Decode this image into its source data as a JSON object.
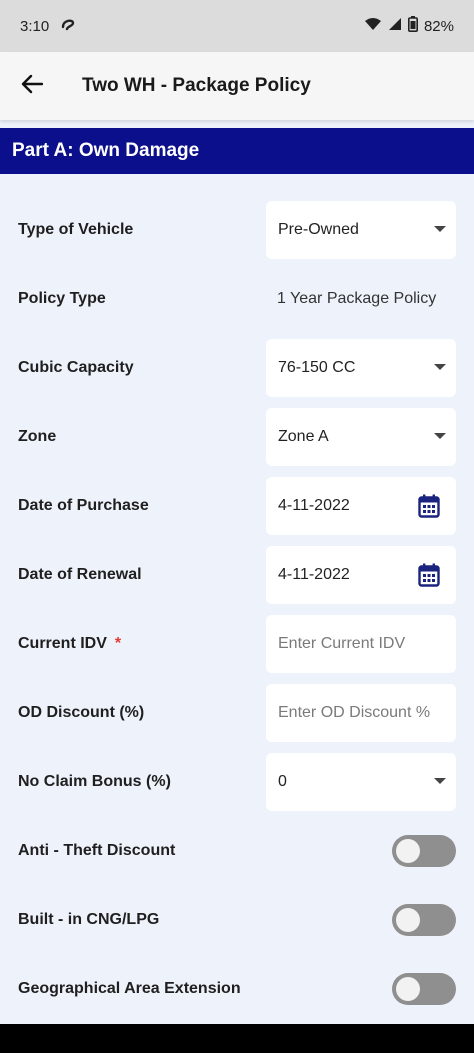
{
  "status": {
    "time": "3:10",
    "battery": "82%"
  },
  "header": {
    "title": "Two WH - Package Policy"
  },
  "section": {
    "title": "Part A: Own Damage"
  },
  "form": {
    "vehicle_type": {
      "label": "Type of Vehicle",
      "value": "Pre-Owned"
    },
    "policy_type": {
      "label": "Policy Type",
      "value": "1 Year Package Policy"
    },
    "cubic_capacity": {
      "label": "Cubic Capacity",
      "value": "76-150 CC"
    },
    "zone": {
      "label": "Zone",
      "value": "Zone A"
    },
    "date_purchase": {
      "label": "Date of Purchase",
      "value": "4-11-2022"
    },
    "date_renewal": {
      "label": "Date of Renewal",
      "value": "4-11-2022"
    },
    "current_idv": {
      "label": "Current IDV",
      "required": "*",
      "placeholder": "Enter Current IDV"
    },
    "od_discount": {
      "label": "OD Discount (%)",
      "placeholder": "Enter OD Discount %"
    },
    "no_claim_bonus": {
      "label": "No Claim Bonus (%)",
      "value": "0"
    },
    "anti_theft": {
      "label": "Anti - Theft Discount",
      "on": false
    },
    "cng_lpg": {
      "label": "Built - in CNG/LPG",
      "on": false
    },
    "geo_extension": {
      "label": "Geographical Area Extension",
      "on": false
    }
  },
  "colors": {
    "header_bg": "#0b0f8c",
    "background": "#eef3fb",
    "calendar_icon": "#1a237e",
    "toggle_off": "#8f8f8f"
  }
}
